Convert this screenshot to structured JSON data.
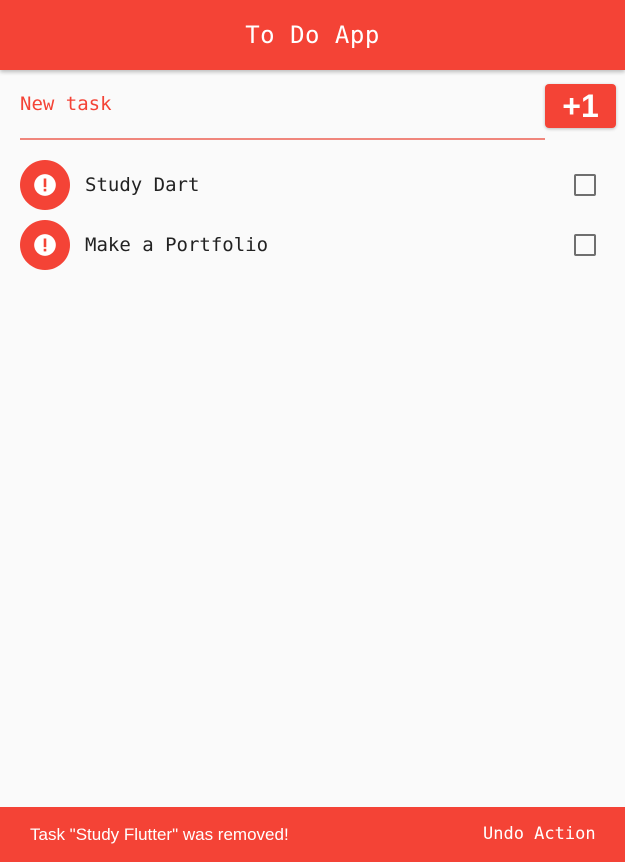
{
  "app_bar": {
    "title": "To Do App"
  },
  "new_task": {
    "placeholder": "New task",
    "value": "",
    "add_label": "+1"
  },
  "tasks": [
    {
      "title": "Study Dart",
      "icon": "error-icon",
      "checked": false
    },
    {
      "title": "Make a Portfolio",
      "icon": "error-icon",
      "checked": false
    }
  ],
  "snackbar": {
    "message": "Task \"Study Flutter\" was removed!",
    "action_label": "Undo Action"
  },
  "colors": {
    "primary": "#f44336",
    "background": "#fafafa",
    "checkbox_border": "#6f6f6f",
    "underline": "#f0867c"
  }
}
